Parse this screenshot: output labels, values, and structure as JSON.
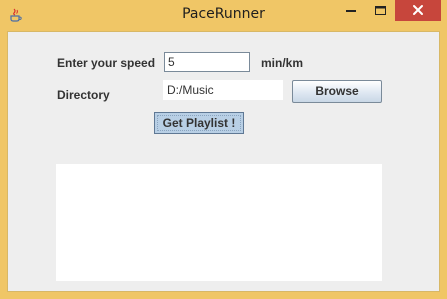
{
  "window": {
    "title": "PaceRunner",
    "app_icon": "java-icon",
    "controls": {
      "minimize_icon": "minimize-icon",
      "maximize_icon": "maximize-icon",
      "close_icon": "close-icon"
    }
  },
  "form": {
    "speed_label": "Enter your speed",
    "speed_value": "5",
    "speed_unit": "min/km",
    "directory_label": "Directory",
    "directory_value": "D:/Music",
    "browse_label": "Browse",
    "get_playlist_label": "Get Playlist !"
  },
  "output": {
    "text": ""
  },
  "colors": {
    "titlebar": "#f0c666",
    "close_button": "#c7463c",
    "content_background": "#eeeeee",
    "button_pressed": "#b8cfe5"
  }
}
